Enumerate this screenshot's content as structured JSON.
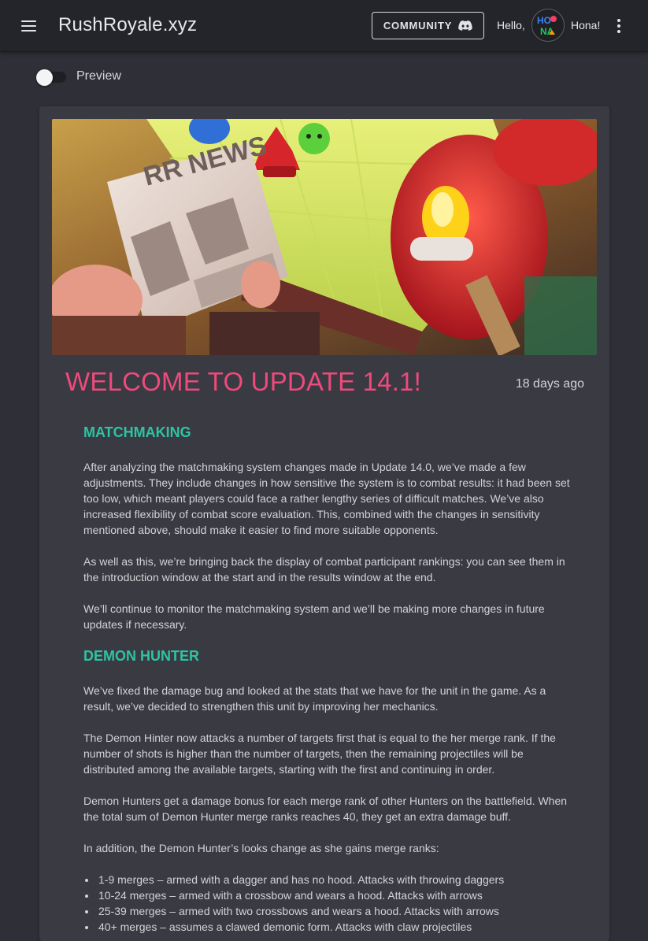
{
  "header": {
    "site_title": "RushRoyale.xyz",
    "community_label": "COMMUNITY",
    "greeting": "Hello,",
    "username": "Hona!",
    "avatar_text": [
      "HO",
      "NA"
    ]
  },
  "preview_toggle": {
    "label": "Preview",
    "enabled": false
  },
  "post": {
    "image_sign_text": "RR NEWS",
    "title": "WELCOME TO UPDATE 14.1!",
    "date": "18 days ago",
    "sections": [
      {
        "heading": "MATCHMAKING",
        "paragraphs": [
          "After analyzing the matchmaking system changes made in Update 14.0, we’ve made a few adjustments. They include changes in how sensitive the system is to combat results: it had been set too low, which meant players could face a rather lengthy series of difficult matches. We’ve also increased flexibility of combat score evaluation. This, combined with the changes in sensitivity mentioned above, should make it easier to find more suitable opponents.",
          "As well as this, we’re bringing back the display of combat participant rankings: you can see them in the introduction window at the start and in the results window at the end.",
          "We’ll continue to monitor the matchmaking system and we’ll be making more changes in future updates if necessary."
        ]
      },
      {
        "heading": "DEMON HUNTER",
        "paragraphs": [
          "We’ve fixed the damage bug and looked at the stats that we have for the unit in the game. As a result, we’ve decided to strengthen this unit by improving her mechanics.",
          "The Demon Hinter now attacks a number of targets first that is equal to the her merge rank. If the number of shots is higher than the number of targets, then the remaining projectiles will be distributed among the available targets, starting with the first and continuing in order.",
          "Demon Hunters get a damage bonus for each merge rank of other Hunters on the battlefield. When the total sum of Demon Hunter merge ranks reaches 40, they get an extra damage buff.",
          "In addition, the Demon Hunter’s looks change as she gains merge ranks:"
        ],
        "bullets": [
          "1-9 merges – armed with a dagger and has no hood. Attacks with throwing daggers",
          "10-24 merges – armed with a crossbow and wears a hood. Attacks with arrows",
          "25-39 merges – armed with two crossbows and wears a hood. Attacks with arrows",
          "40+ merges – assumes a clawed demonic form. Attacks with claw projectiles"
        ]
      }
    ]
  },
  "colors": {
    "page_background": "#2f3037",
    "topbar_background": "#24252b",
    "card_background": "#393a42",
    "title_accent": "#ee4a7b",
    "heading_accent": "#2fc3a4"
  }
}
